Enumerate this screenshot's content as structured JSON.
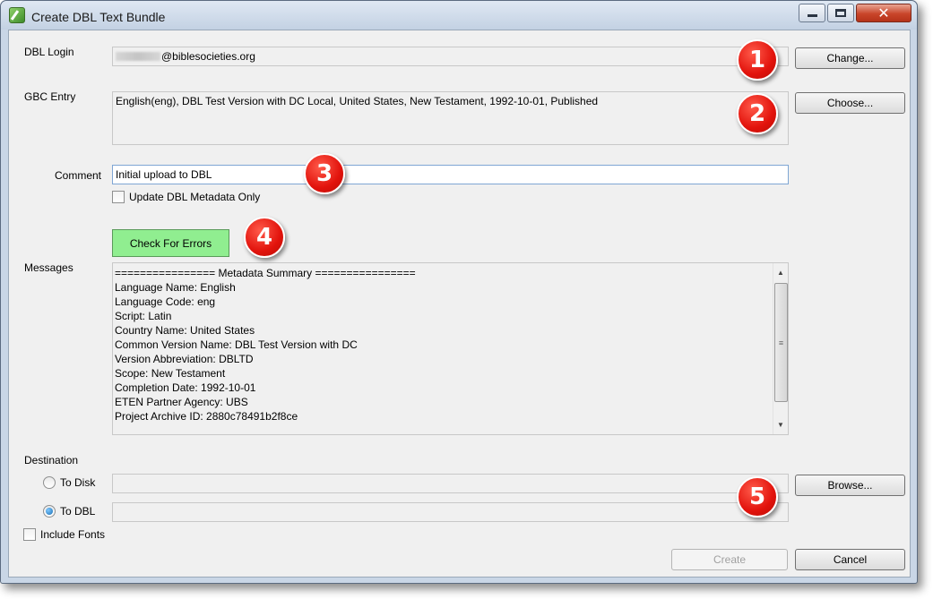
{
  "window": {
    "title": "Create DBL Text Bundle",
    "controls": {
      "minimize": "—",
      "maximize": "□",
      "close": "✕"
    }
  },
  "login": {
    "label": "DBL Login",
    "value_domain": "@biblesocieties.org",
    "change_button": "Change..."
  },
  "gbc": {
    "label": "GBC Entry",
    "value": "English(eng), DBL Test Version with DC Local, United States, New Testament, 1992-10-01, Published",
    "choose_button": "Choose..."
  },
  "comment": {
    "label": "Comment",
    "value": "Initial upload to DBL",
    "update_metadata_only_label": "Update DBL Metadata Only",
    "update_metadata_only_checked": false
  },
  "check_errors_button": "Check For Errors",
  "messages": {
    "label": "Messages",
    "lines": [
      "================ Metadata Summary ================",
      "Language Name: English",
      "Language Code: eng",
      "Script: Latin",
      "Country Name: United States",
      "Common Version Name: DBL Test Version with DC",
      "Version Abbreviation: DBLTD",
      "Scope: New Testament",
      "Completion Date: 1992-10-01",
      "ETEN Partner Agency: UBS",
      "Project Archive ID: 2880c78491b2f8ce"
    ]
  },
  "destination": {
    "label": "Destination",
    "to_disk_label": "To Disk",
    "to_disk_checked": false,
    "to_dbl_label": "To DBL",
    "to_dbl_checked": true,
    "browse_button": "Browse...",
    "include_fonts_label": "Include Fonts",
    "include_fonts_checked": false
  },
  "footer": {
    "create_button": "Create",
    "cancel_button": "Cancel"
  },
  "callouts": [
    "1",
    "2",
    "3",
    "4",
    "5"
  ],
  "colors": {
    "check_button_bg": "#90ee90",
    "callout_red": "#e2130c",
    "close_button": "#c9452a"
  }
}
